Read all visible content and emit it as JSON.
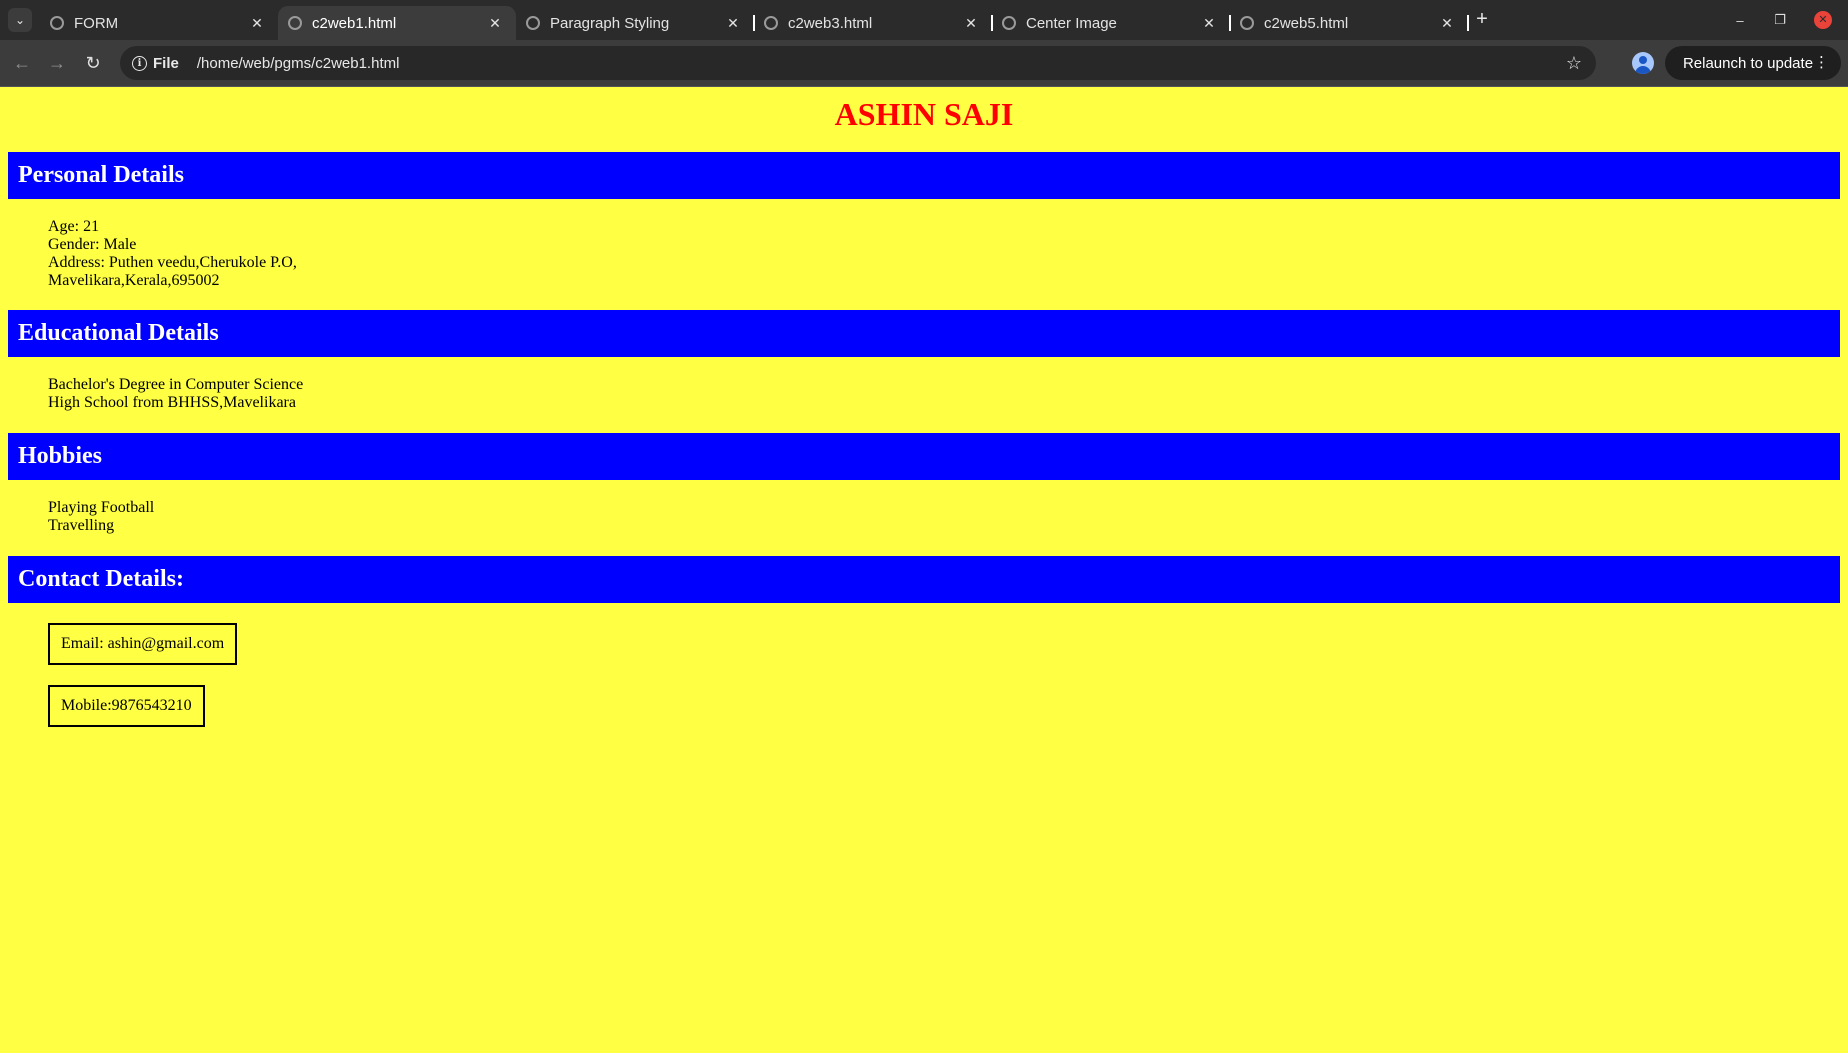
{
  "browser": {
    "tabs": [
      {
        "title": "FORM",
        "active": false
      },
      {
        "title": "c2web1.html",
        "active": true
      },
      {
        "title": "Paragraph Styling",
        "active": false
      },
      {
        "title": "c2web3.html",
        "active": false
      },
      {
        "title": "Center Image",
        "active": false
      },
      {
        "title": "c2web5.html",
        "active": false
      }
    ],
    "address_scheme": "File",
    "address_path": "/home/web/pgms/c2web1.html",
    "relaunch_label": "Relaunch to update"
  },
  "page": {
    "name": "ASHIN SAJI",
    "sections": {
      "personal": {
        "heading": "Personal Details",
        "lines": [
          "Age: 21",
          "Gender: Male",
          "Address: Puthen veedu,Cherukole P.O,",
          "Mavelikara,Kerala,695002"
        ]
      },
      "education": {
        "heading": "Educational Details",
        "lines": [
          "Bachelor's Degree in Computer Science",
          "High School from BHHSS,Mavelikara"
        ]
      },
      "hobbies": {
        "heading": "Hobbies",
        "lines": [
          "Playing Football",
          "Travelling"
        ]
      },
      "contact": {
        "heading": "Contact Details:",
        "email": "Email: ashin@gmail.com",
        "mobile": "Mobile:9876543210"
      }
    }
  },
  "colors": {
    "page_background": "#ffff44",
    "name_color": "#ff0000",
    "section_header_bg": "#0000ff",
    "section_header_text": "#ffffff"
  }
}
